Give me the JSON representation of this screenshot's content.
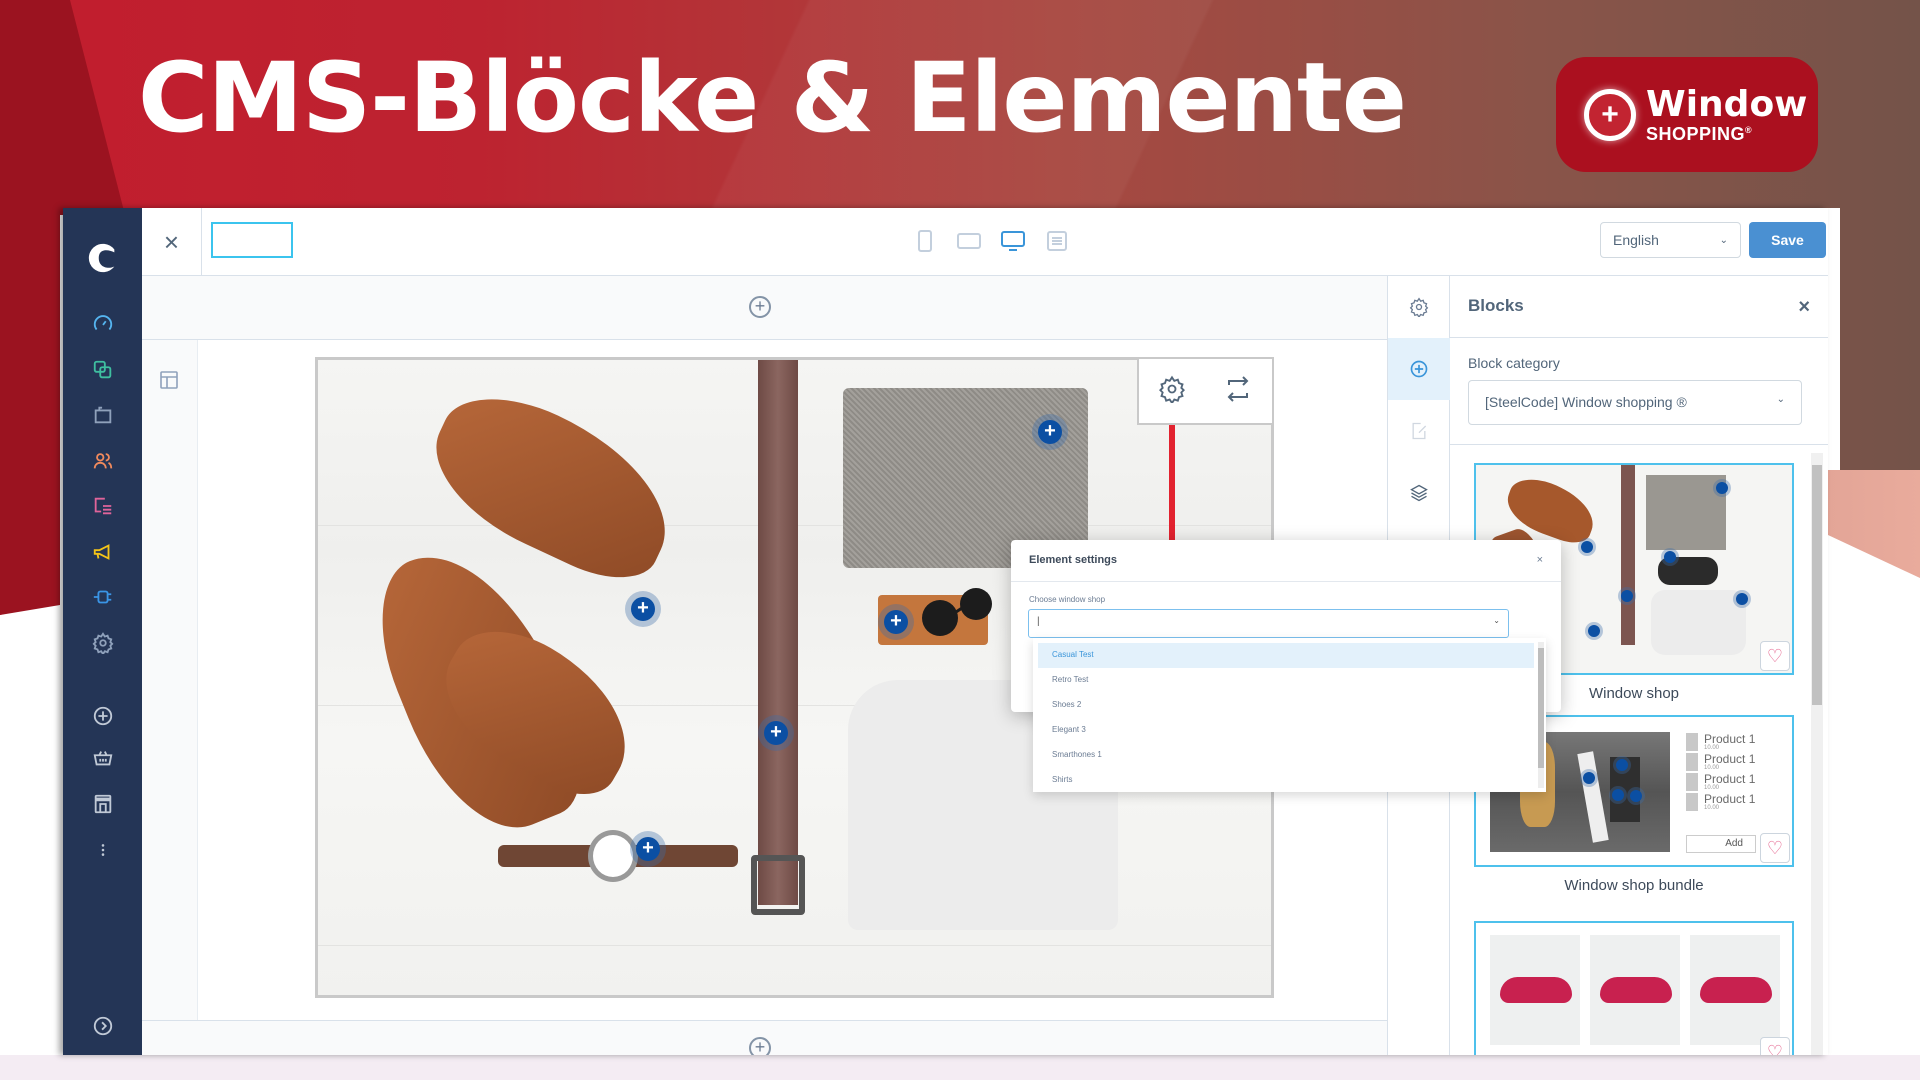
{
  "banner": {
    "title": "CMS-Blöcke & Elemente",
    "logo": {
      "line1": "Window",
      "line2": "SHOPPING",
      "registered": "®",
      "icon": "plus-circle-icon"
    }
  },
  "colors": {
    "brand_red": "#ab101f",
    "sidebar_bg": "#243556",
    "accent_blue": "#4a90d2",
    "selection_blue": "#3bc4ee",
    "hotspot_blue": "#0b4fa3"
  },
  "sidebar": {
    "items": [
      {
        "icon": "shopware-logo-icon"
      },
      {
        "icon": "dashboard-icon"
      },
      {
        "icon": "catalogue-icon"
      },
      {
        "icon": "orders-bag-icon"
      },
      {
        "icon": "customers-icon"
      },
      {
        "icon": "content-icon"
      },
      {
        "icon": "marketing-megaphone-icon"
      },
      {
        "icon": "extensions-plug-icon"
      },
      {
        "icon": "settings-gear-icon"
      },
      {
        "icon": "add-sales-channel-icon"
      },
      {
        "icon": "basket-icon"
      },
      {
        "icon": "storefront-icon"
      },
      {
        "icon": "more-dots-icon"
      },
      {
        "icon": "expand-chevron-icon"
      }
    ]
  },
  "toolbar": {
    "close_label": "×",
    "name_input_value": "",
    "devices": [
      "mobile",
      "tablet",
      "desktop",
      "list"
    ],
    "active_device": "desktop",
    "language": "English",
    "save_label": "Save"
  },
  "canvas": {
    "add_section_label": "+",
    "hotspots": [
      "+",
      "+",
      "+",
      "+",
      "+"
    ],
    "element_toolbar": [
      "settings-gear-icon",
      "swap-icon"
    ]
  },
  "element_settings": {
    "title": "Element settings",
    "close_label": "×",
    "field_label": "Choose window shop",
    "input_value": "",
    "options": [
      "Casual Test",
      "Retro Test",
      "Shoes 2",
      "Elegant 3",
      "Smarthones 1",
      "Shirts"
    ],
    "highlighted_option": "Casual Test"
  },
  "right_icons": [
    "settings-gear-icon",
    "add-block-icon",
    "edit-icon",
    "layers-icon"
  ],
  "blocks_panel": {
    "title": "Blocks",
    "close_label": "×",
    "category_label": "Block category",
    "category_value": "[SteelCode] Window shopping ®",
    "blocks": [
      {
        "name": "Window shop"
      },
      {
        "name": "Window shop bundle",
        "products": [
          {
            "name": "Product 1",
            "price": "10.00"
          },
          {
            "name": "Product 1",
            "price": "10.00"
          },
          {
            "name": "Product 1",
            "price": "10.00"
          },
          {
            "name": "Product 1",
            "price": "10.00"
          }
        ],
        "add_label": "Add"
      },
      {
        "name": ""
      }
    ]
  }
}
